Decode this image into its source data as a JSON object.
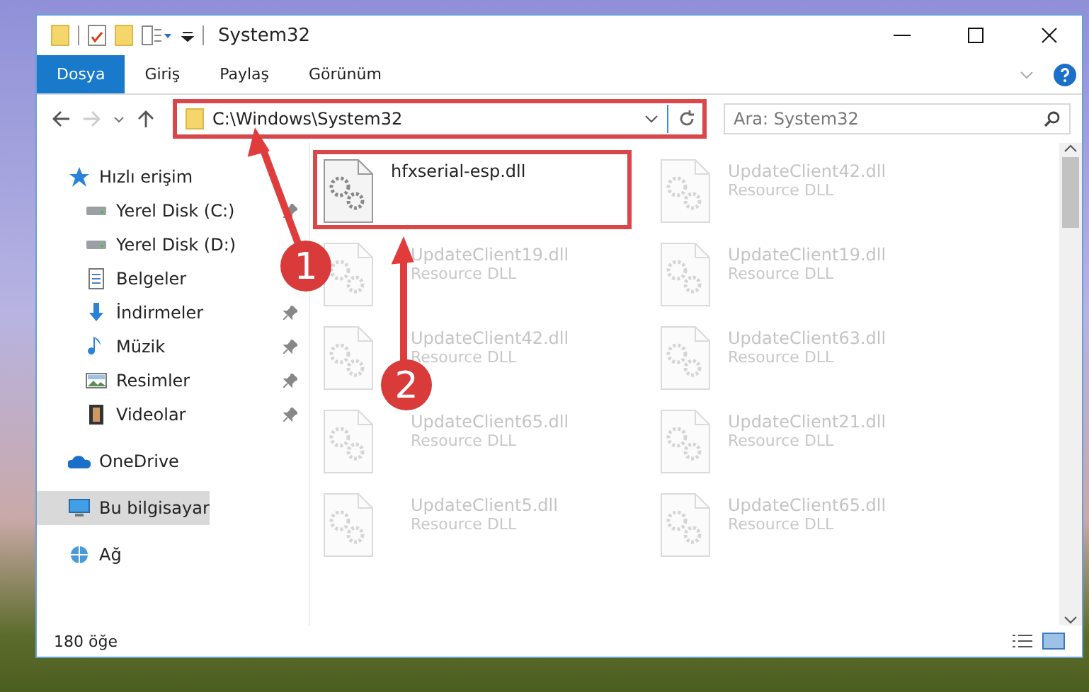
{
  "window": {
    "title": "System32"
  },
  "ribbon_tabs": [
    {
      "label": "Dosya",
      "selected": true
    },
    {
      "label": "Giriş",
      "selected": false
    },
    {
      "label": "Paylaş",
      "selected": false
    },
    {
      "label": "Görünüm",
      "selected": false
    }
  ],
  "address": {
    "value": "C:\\Windows\\System32",
    "highlighted": true
  },
  "search": {
    "placeholder": "Ara: System32"
  },
  "sidebar": {
    "items": [
      {
        "label": "Hızlı erişim",
        "kind": "star",
        "selected": false,
        "children": [
          {
            "label": "Yerel Disk (C:)",
            "kind": "drive",
            "pinned": true
          },
          {
            "label": "Yerel Disk (D:)",
            "kind": "drive",
            "pinned": false
          },
          {
            "label": "Belgeler",
            "kind": "document",
            "pinned": false
          },
          {
            "label": "İndirmeler",
            "kind": "download",
            "pinned": true
          },
          {
            "label": "Müzik",
            "kind": "music",
            "pinned": true
          },
          {
            "label": "Resimler",
            "kind": "picture",
            "pinned": true
          },
          {
            "label": "Videolar",
            "kind": "film",
            "pinned": true
          }
        ]
      },
      {
        "label": "OneDrive",
        "kind": "cloud",
        "selected": false
      },
      {
        "label": "Bu bilgisayar",
        "kind": "computer",
        "selected": true
      },
      {
        "label": "Ağ",
        "kind": "network",
        "selected": false
      }
    ]
  },
  "files": [
    {
      "name": "hfxserial-esp.dll",
      "highlighted": true,
      "blurred": false
    },
    {
      "name": "UpdateClient42.dll",
      "type": "Resource DLL",
      "highlighted": false,
      "blurred": true
    },
    {
      "name": "UpdateClient19.dll",
      "type": "Resource DLL",
      "highlighted": false,
      "blurred": true
    },
    {
      "name": "UpdateClient19.dll",
      "type": "Resource DLL",
      "highlighted": false,
      "blurred": true
    },
    {
      "name": "UpdateClient42.dll",
      "type": "Resource DLL",
      "highlighted": false,
      "blurred": true
    },
    {
      "name": "UpdateClient63.dll",
      "type": "Resource DLL",
      "highlighted": false,
      "blurred": true
    },
    {
      "name": "UpdateClient65.dll",
      "type": "Resource DLL",
      "highlighted": false,
      "blurred": true
    },
    {
      "name": "UpdateClient21.dll",
      "type": "Resource DLL",
      "highlighted": false,
      "blurred": true
    },
    {
      "name": "UpdateClient5.dll",
      "type": "Resource DLL",
      "highlighted": false,
      "blurred": true
    },
    {
      "name": "UpdateClient65.dll",
      "type": "Resource DLL",
      "highlighted": false,
      "blurred": true
    }
  ],
  "status_bar": {
    "item_count": "180 öğe"
  },
  "annotations": [
    {
      "label": "1"
    },
    {
      "label": "2"
    }
  ]
}
